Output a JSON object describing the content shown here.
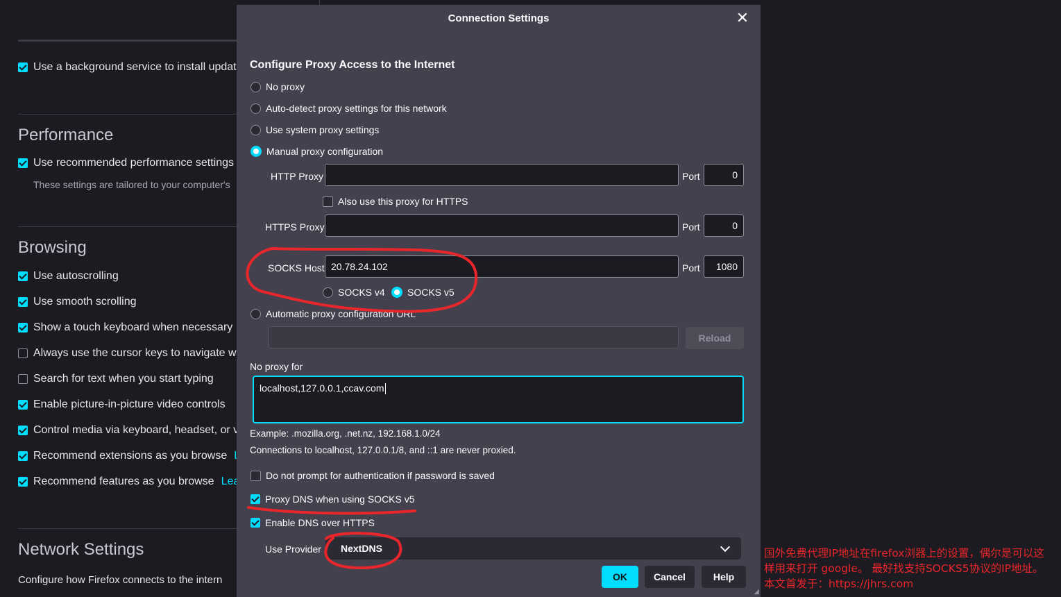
{
  "background": {
    "background_service": "Use a background service to install updat",
    "performance_heading": "Performance",
    "use_recommended": "Use recommended performance settings",
    "tailored_note": "These settings are tailored to your computer's",
    "browsing_heading": "Browsing",
    "items": [
      {
        "label": "Use autoscrolling",
        "checked": true
      },
      {
        "label": "Use smooth scrolling",
        "checked": true
      },
      {
        "label": "Show a touch keyboard when necessary",
        "checked": true
      },
      {
        "label": "Always use the cursor keys to navigate w",
        "checked": false
      },
      {
        "label": "Search for text when you start typing",
        "checked": false
      },
      {
        "label": "Enable picture-in-picture video controls",
        "checked": true
      },
      {
        "label": "Control media via keyboard, headset, or v",
        "checked": true
      },
      {
        "label": "Recommend extensions as you browse",
        "checked": true
      },
      {
        "label": "Recommend features as you browse",
        "checked": true
      }
    ],
    "learn_more_1": "L",
    "learn_more_2": "Lea",
    "network_heading": "Network Settings",
    "network_desc": "Configure how Firefox connects to the intern"
  },
  "dialog": {
    "title": "Connection Settings",
    "section_title": "Configure Proxy Access to the Internet",
    "radio_no_proxy": "No proxy",
    "radio_auto_detect": "Auto-detect proxy settings for this network",
    "radio_system": "Use system proxy settings",
    "radio_manual": "Manual proxy configuration",
    "http_proxy_label": "HTTP Proxy",
    "http_proxy_value": "",
    "port_label": "Port",
    "http_port": "0",
    "also_https": "Also use this proxy for HTTPS",
    "https_proxy_label": "HTTPS Proxy",
    "https_proxy_value": "",
    "https_port": "0",
    "socks_host_label": "SOCKS Host",
    "socks_host_value": "20.78.24.102",
    "socks_port": "1080",
    "socks_v4": "SOCKS v4",
    "socks_v5": "SOCKS v5",
    "radio_auto_url": "Automatic proxy configuration URL",
    "auto_url_value": "",
    "reload": "Reload",
    "no_proxy_for": "No proxy for",
    "no_proxy_value": "localhost,127.0.0.1,ccav.com",
    "example": "Example: .mozilla.org, .net.nz, 192.168.1.0/24",
    "never_proxied": "Connections to localhost, 127.0.0.1/8, and ::1 are never proxied.",
    "no_prompt_auth": "Do not prompt for authentication if password is saved",
    "proxy_dns": "Proxy DNS when using SOCKS v5",
    "enable_doh": "Enable DNS over HTTPS",
    "use_provider": "Use Provider",
    "provider_value": "NextDNS",
    "ok": "OK",
    "cancel": "Cancel",
    "help": "Help"
  },
  "annotation": {
    "line1": "国外免费代理IP地址在firefox浏器上的设置，偶尔是可以这",
    "line2": "样用来打开 google。 最好找支持SOCKS5协议的IP地址。",
    "line3": "本文首发于：https://jhrs.com",
    "color": "#e8262b"
  },
  "colors": {
    "accent": "#00ddff",
    "dialog_bg": "#42414d",
    "page_bg": "#1c1b22"
  }
}
